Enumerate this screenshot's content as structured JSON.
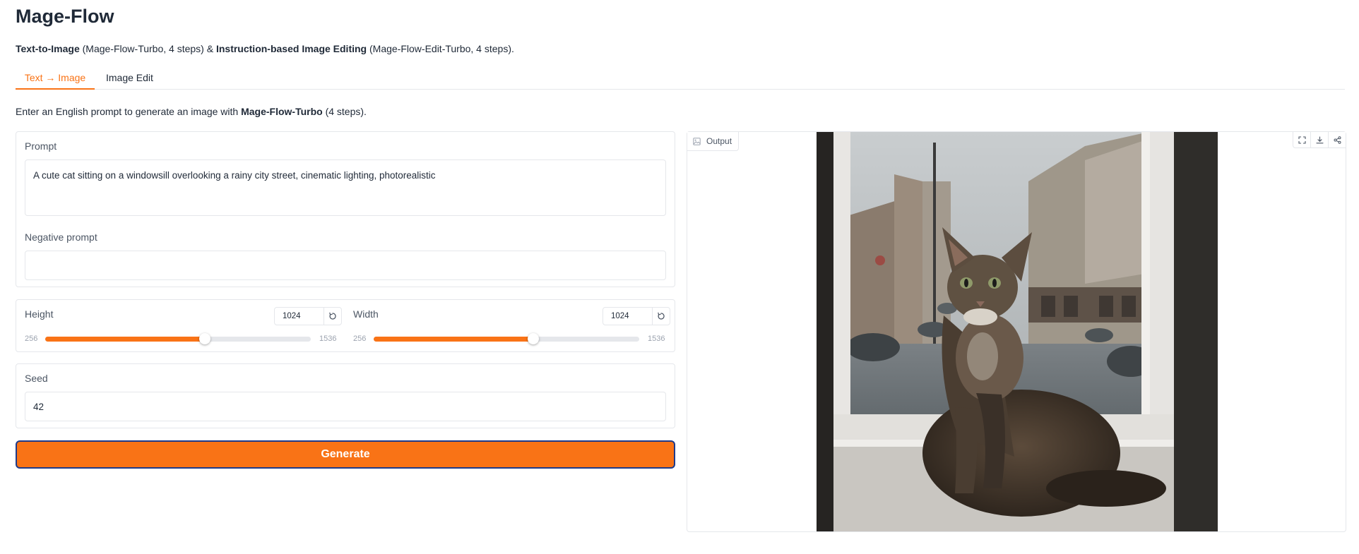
{
  "app": {
    "title": "Mage-Flow",
    "subtitle": {
      "part1_bold": "Text-to-Image",
      "part2": " (Mage-Flow-Turbo, 4 steps) & ",
      "part3_bold": "Instruction-based Image Editing",
      "part4": " (Mage-Flow-Edit-Turbo, 4 steps)."
    }
  },
  "tabs": [
    {
      "label": "Text → Image",
      "active": true
    },
    {
      "label": "Image Edit",
      "active": false
    }
  ],
  "description": {
    "prefix": "Enter an English prompt to generate an image with ",
    "model_bold": "Mage-Flow-Turbo",
    "suffix": " (4 steps)."
  },
  "prompt": {
    "label": "Prompt",
    "value": "A cute cat sitting on a windowsill overlooking a rainy city street, cinematic lighting, photorealistic"
  },
  "negative_prompt": {
    "label": "Negative prompt",
    "value": ""
  },
  "height": {
    "label": "Height",
    "value": "1024",
    "min": "256",
    "max": "1536",
    "fraction": 0.6
  },
  "width": {
    "label": "Width",
    "value": "1024",
    "min": "256",
    "max": "1536",
    "fraction": 0.6
  },
  "seed": {
    "label": "Seed",
    "value": "42"
  },
  "generate_button": {
    "label": "Generate"
  },
  "output": {
    "label": "Output"
  },
  "colors": {
    "accent": "#f97316",
    "button_border": "#1e3a8a",
    "border": "#e5e7eb"
  },
  "icons": {
    "output_label": "image-icon",
    "reset": "reset-icon",
    "fullscreen": "fullscreen-icon",
    "download": "download-icon",
    "share": "share-icon"
  }
}
